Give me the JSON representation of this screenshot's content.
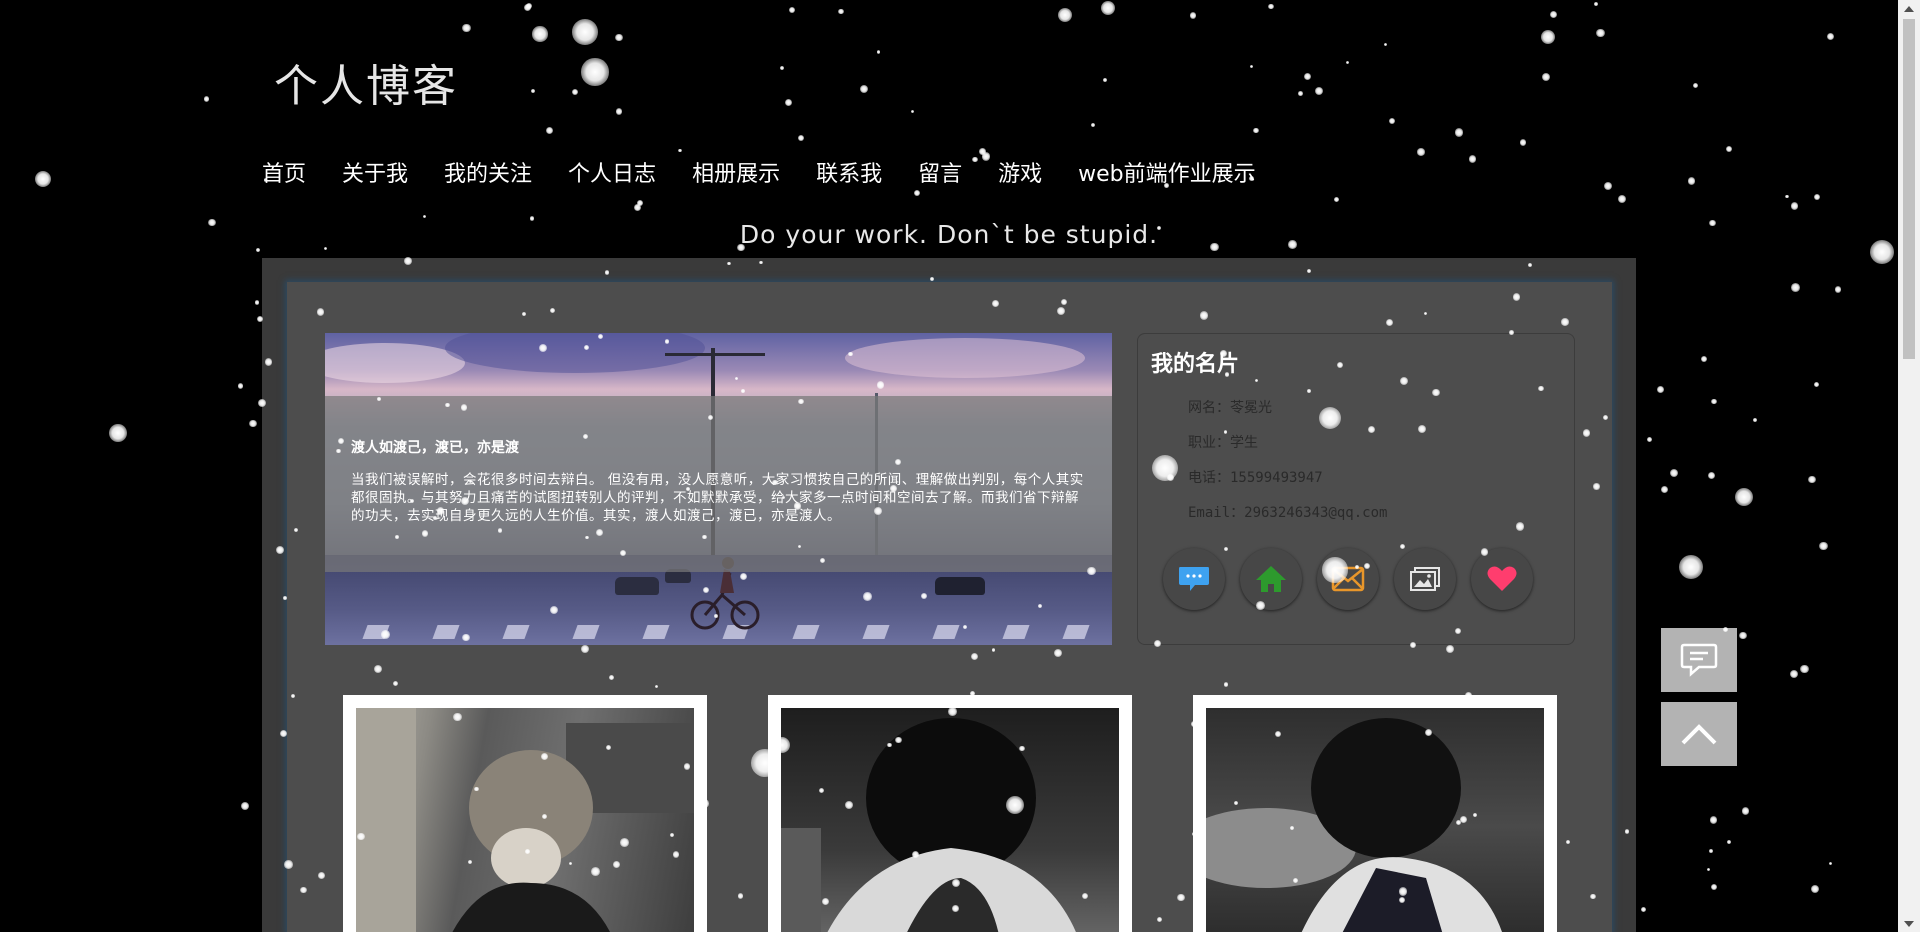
{
  "header": {
    "site_title": "个人博客",
    "motto": "Do your work. Don`t be stupid."
  },
  "nav": {
    "items": [
      "首页",
      "关于我",
      "我的关注",
      "个人日志",
      "相册展示",
      "联系我",
      "留言",
      "游戏",
      "web前端作业展示"
    ]
  },
  "banner": {
    "quote_title": "渡人如渡己，渡已，亦是渡",
    "quote_body": "当我们被误解时，会花很多时间去辩白。 但没有用，没人愿意听，大家习惯按自己的所闻、理解做出判别，每个人其实都很固执。与其努力且痛苦的试图扭转别人的评判，不如默默承受，给大家多一点时间和空间去了解。而我们省下辩解的功夫，去实现自身更久远的人生价值。其实，渡人如渡己，渡已，亦是渡人。"
  },
  "card": {
    "title": "我的名片",
    "name": "网名：苓冕光",
    "job": "职业：学生",
    "phone": "电话：15599493947",
    "email": "Email：2963246343@qq.com",
    "icons": [
      {
        "name": "chat-bubble-icon",
        "color": "#3ea2f0"
      },
      {
        "name": "home-icon",
        "color": "#2d9a2d"
      },
      {
        "name": "mail-icon",
        "color": "#e8962a"
      },
      {
        "name": "gallery-icon",
        "color": "#e6e6e6"
      },
      {
        "name": "heart-icon",
        "color": "#ff3d6e"
      }
    ]
  },
  "colors": {
    "background": "#000000",
    "panel": "#4d4d4d",
    "side_button": "#b3b3b3"
  }
}
